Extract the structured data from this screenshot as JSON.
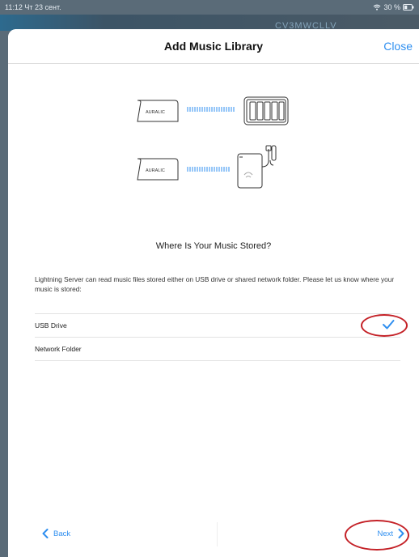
{
  "status_bar": {
    "time": "11:12",
    "date": "Чт 23 сент.",
    "battery": "30 %"
  },
  "background": {
    "ghost_text": "CV3MWCLLV"
  },
  "dialog": {
    "title": "Add Music Library",
    "close_label": "Close"
  },
  "illustration": {
    "device_brand": "AURALIC"
  },
  "content": {
    "question": "Where Is Your Music Stored?",
    "description": "Lightning Server can read music files stored either on USB drive or shared network folder. Please let us know where your music is stored:"
  },
  "options": [
    {
      "label": "USB Drive",
      "selected": true
    },
    {
      "label": "Network Folder",
      "selected": false
    }
  ],
  "footer": {
    "back_label": "Back",
    "next_label": "Next"
  },
  "colors": {
    "accent": "#2f8ff0",
    "annotation": "#c42127"
  }
}
